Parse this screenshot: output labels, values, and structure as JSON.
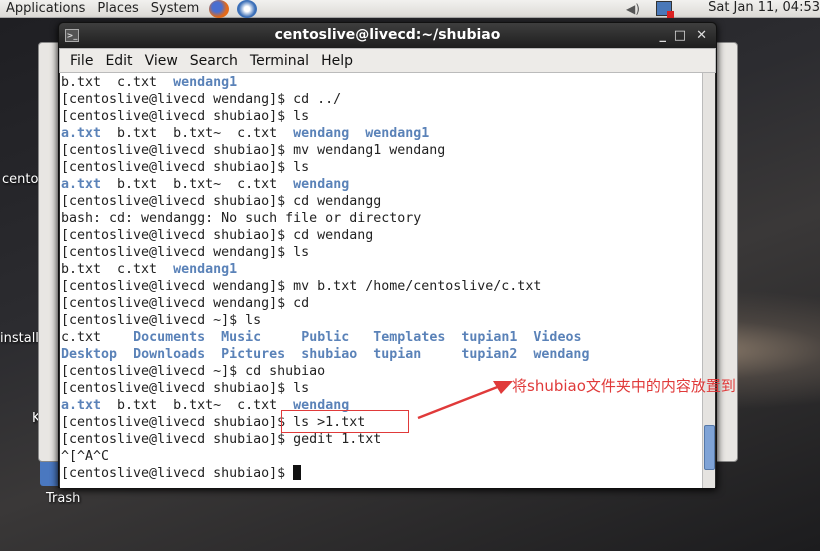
{
  "panel": {
    "menus": [
      "Applications",
      "Places",
      "System"
    ],
    "clock": "Sat Jan 11, 04:53"
  },
  "desktop": {
    "icons": [
      "centos",
      "install",
      "Key",
      "Trash"
    ]
  },
  "window": {
    "title": "centoslive@livecd:~/shubiao",
    "menu": [
      "File",
      "Edit",
      "View",
      "Search",
      "Terminal",
      "Help"
    ]
  },
  "terminal": {
    "lines": [
      [
        [
          "b.txt  c.txt  ",
          0
        ],
        [
          "wendang1",
          1
        ]
      ],
      [
        [
          "[centoslive@livecd wendang]$ cd ../",
          0
        ]
      ],
      [
        [
          "[centoslive@livecd shubiao]$ ls",
          0
        ]
      ],
      [
        [
          "a.txt",
          1
        ],
        [
          "  b.txt  b.txt~  c.txt  ",
          0
        ],
        [
          "wendang",
          1
        ],
        [
          "  ",
          0
        ],
        [
          "wendang1",
          1
        ]
      ],
      [
        [
          "[centoslive@livecd shubiao]$ mv wendang1 wendang",
          0
        ]
      ],
      [
        [
          "[centoslive@livecd shubiao]$ ls",
          0
        ]
      ],
      [
        [
          "a.txt",
          1
        ],
        [
          "  b.txt  b.txt~  c.txt  ",
          0
        ],
        [
          "wendang",
          1
        ]
      ],
      [
        [
          "[centoslive@livecd shubiao]$ cd wendangg",
          0
        ]
      ],
      [
        [
          "bash: cd: wendangg: No such file or directory",
          0
        ]
      ],
      [
        [
          "[centoslive@livecd shubiao]$ cd wendang",
          0
        ]
      ],
      [
        [
          "[centoslive@livecd wendang]$ ls",
          0
        ]
      ],
      [
        [
          "b.txt  c.txt  ",
          0
        ],
        [
          "wendang1",
          1
        ]
      ],
      [
        [
          "[centoslive@livecd wendang]$ mv b.txt /home/centoslive/c.txt",
          0
        ]
      ],
      [
        [
          "[centoslive@livecd wendang]$ cd",
          0
        ]
      ],
      [
        [
          "[centoslive@livecd ~]$ ls",
          0
        ]
      ],
      [
        [
          "c.txt    ",
          0
        ],
        [
          "Documents",
          1
        ],
        [
          "  ",
          0
        ],
        [
          "Music",
          1
        ],
        [
          "     ",
          0
        ],
        [
          "Public",
          1
        ],
        [
          "   ",
          0
        ],
        [
          "Templates",
          1
        ],
        [
          "  ",
          0
        ],
        [
          "tupian1",
          1
        ],
        [
          "  ",
          0
        ],
        [
          "Videos",
          1
        ]
      ],
      [
        [
          "Desktop",
          1
        ],
        [
          "  ",
          0
        ],
        [
          "Downloads",
          1
        ],
        [
          "  ",
          0
        ],
        [
          "Pictures",
          1
        ],
        [
          "  ",
          0
        ],
        [
          "shubiao",
          1
        ],
        [
          "  ",
          0
        ],
        [
          "tupian",
          1
        ],
        [
          "     ",
          0
        ],
        [
          "tupian2",
          1
        ],
        [
          "  ",
          0
        ],
        [
          "wendang",
          1
        ]
      ],
      [
        [
          "[centoslive@livecd ~]$ cd shubiao",
          0
        ]
      ],
      [
        [
          "[centoslive@livecd shubiao]$ ls",
          0
        ]
      ],
      [
        [
          "a.txt",
          1
        ],
        [
          "  b.txt  b.txt~  c.txt  ",
          0
        ],
        [
          "wendang",
          1
        ]
      ],
      [
        [
          "[centoslive@livecd shubiao]$ ls >1.txt",
          0
        ]
      ],
      [
        [
          "[centoslive@livecd shubiao]$ gedit 1.txt",
          0
        ]
      ],
      [
        [
          "^[^A^C",
          0
        ]
      ],
      [
        [
          "[centoslive@livecd shubiao]$ ",
          0
        ]
      ]
    ]
  },
  "annotation": {
    "text": "将shubiao文件夹中的内容放置到",
    "color": "#e03a3a"
  }
}
